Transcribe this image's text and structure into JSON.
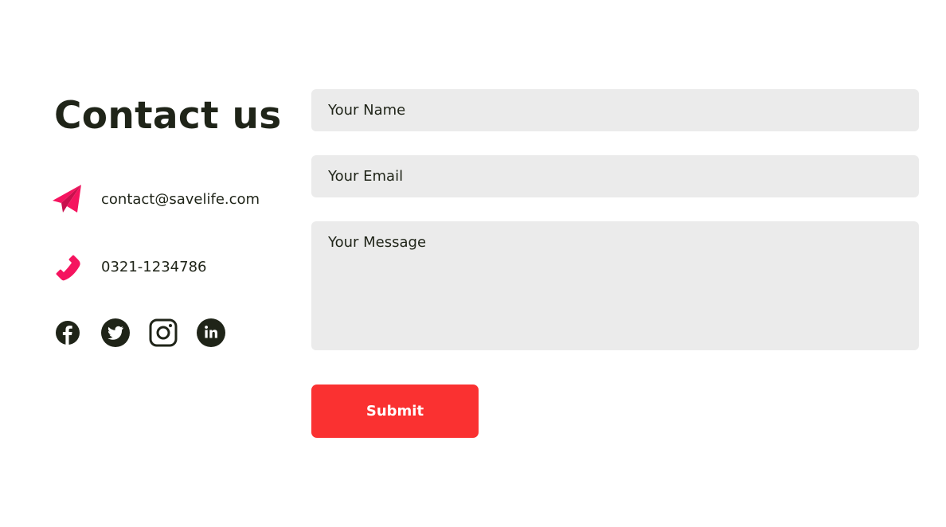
{
  "contact": {
    "title": "Contact us",
    "email": "contact@savelife.com",
    "phone": "0321-1234786",
    "icons": [
      "paper-plane-icon",
      "phone-icon"
    ],
    "social": [
      "facebook-icon",
      "twitter-icon",
      "instagram-icon",
      "linkedin-icon"
    ]
  },
  "form": {
    "name_placeholder": "Your Name",
    "email_placeholder": "Your Email",
    "message_placeholder": "Your Message",
    "submit_label": "Submit"
  },
  "colors": {
    "accent_pink": "#f5145f",
    "submit_red": "#fa3131",
    "text_dark": "#1f2418",
    "field_bg": "#ebebeb"
  }
}
